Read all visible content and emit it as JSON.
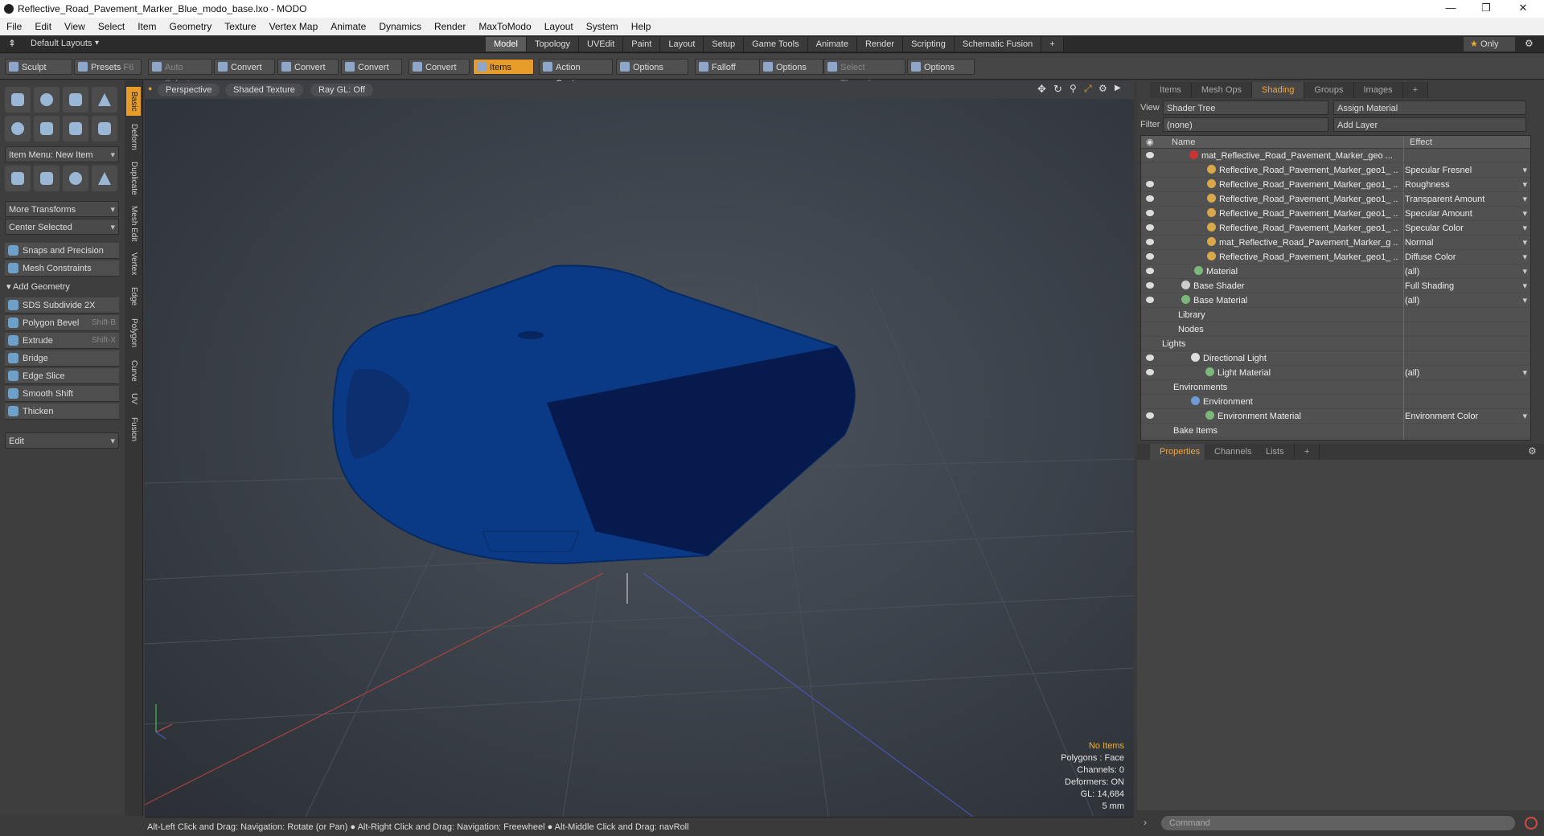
{
  "title": "Reflective_Road_Pavement_Marker_Blue_modo_base.lxo - MODO",
  "menu": [
    "File",
    "Edit",
    "View",
    "Select",
    "Item",
    "Geometry",
    "Texture",
    "Vertex Map",
    "Animate",
    "Dynamics",
    "Render",
    "MaxToModo",
    "Layout",
    "System",
    "Help"
  ],
  "layout_dropdown": "Default Layouts",
  "top_tabs": [
    "Model",
    "Topology",
    "UVEdit",
    "Paint",
    "Layout",
    "Setup",
    "Game Tools",
    "Animate",
    "Render",
    "Scripting",
    "Schematic Fusion"
  ],
  "only_label": "Only",
  "toolbar": {
    "sculpt": "Sculpt",
    "presets": "Presets",
    "presets_key": "F6",
    "auto_select": "Auto Select",
    "convert": "Convert",
    "items": "Items",
    "action_center": "Action Center",
    "options": "Options",
    "falloff": "Falloff",
    "select_through": "Select Through"
  },
  "left_tabs": [
    "Basic",
    "Deform",
    "Duplicate",
    "Mesh Edit",
    "Vertex",
    "Edge",
    "Polygon",
    "Curve",
    "UV",
    "Fusion"
  ],
  "left": {
    "item_menu": "Item Menu: New Item",
    "more_transforms": "More Transforms",
    "center_selected": "Center Selected",
    "snaps": "Snaps and Precision",
    "mesh_constraints": "Mesh Constraints",
    "add_geometry": "Add Geometry",
    "sds": "SDS Subdivide 2X",
    "polygon_bevel": "Polygon Bevel",
    "polygon_bevel_key": "Shift-B",
    "extrude": "Extrude",
    "extrude_key": "Shift-X",
    "bridge": "Bridge",
    "edge_slice": "Edge Slice",
    "smooth_shift": "Smooth Shift",
    "thicken": "Thicken",
    "edit": "Edit"
  },
  "viewport": {
    "perspective": "Perspective",
    "shaded": "Shaded Texture",
    "raygl": "Ray GL: Off"
  },
  "hud": {
    "no_items": "No Items",
    "polygons": "Polygons : Face",
    "channels": "Channels: 0",
    "deformers": "Deformers: ON",
    "gl": "GL: 14,684",
    "size": "5 mm"
  },
  "status": "Alt-Left Click and Drag: Navigation: Rotate (or Pan) ● Alt-Right Click and Drag: Navigation: Freewheel ● Alt-Middle Click and Drag: navRoll",
  "right_tabs": [
    "Items",
    "Mesh Ops",
    "Shading",
    "Groups",
    "Images"
  ],
  "shader": {
    "view_label": "View",
    "view_value": "Shader Tree",
    "assign_material": "Assign Material",
    "filter_label": "Filter",
    "filter_value": "(none)",
    "add_layer": "Add Layer",
    "col_name": "Name",
    "col_effect": "Effect"
  },
  "tree_rows": [
    {
      "name": "mat_Reflective_Road_Pavement_Marker_geo ...",
      "effect": ""
    },
    {
      "name": "Reflective_Road_Pavement_Marker_geo1_ ...",
      "effect": "Specular Fresnel"
    },
    {
      "name": "Reflective_Road_Pavement_Marker_geo1_ ...",
      "effect": "Roughness"
    },
    {
      "name": "Reflective_Road_Pavement_Marker_geo1_ ...",
      "effect": "Transparent Amount"
    },
    {
      "name": "Reflective_Road_Pavement_Marker_geo1_ ...",
      "effect": "Specular Amount"
    },
    {
      "name": "Reflective_Road_Pavement_Marker_geo1_ ...",
      "effect": "Specular Color"
    },
    {
      "name": "mat_Reflective_Road_Pavement_Marker_g ...",
      "effect": "Normal"
    },
    {
      "name": "Reflective_Road_Pavement_Marker_geo1_ ...",
      "effect": "Diffuse Color"
    },
    {
      "name": "Material",
      "effect": "(all)"
    },
    {
      "name": "Base Shader",
      "effect": "Full Shading"
    },
    {
      "name": "Base Material",
      "effect": "(all)"
    },
    {
      "name": "Library",
      "effect": ""
    },
    {
      "name": "Nodes",
      "effect": ""
    },
    {
      "name": "Lights",
      "effect": ""
    },
    {
      "name": "Directional Light",
      "effect": ""
    },
    {
      "name": "Light Material",
      "effect": "(all)"
    },
    {
      "name": "Environments",
      "effect": ""
    },
    {
      "name": "Environment",
      "effect": ""
    },
    {
      "name": "Environment Material",
      "effect": "Environment Color"
    },
    {
      "name": "Bake Items",
      "effect": ""
    }
  ],
  "bottom_tabs": [
    "Properties",
    "Channels",
    "Lists"
  ],
  "command_placeholder": "Command"
}
